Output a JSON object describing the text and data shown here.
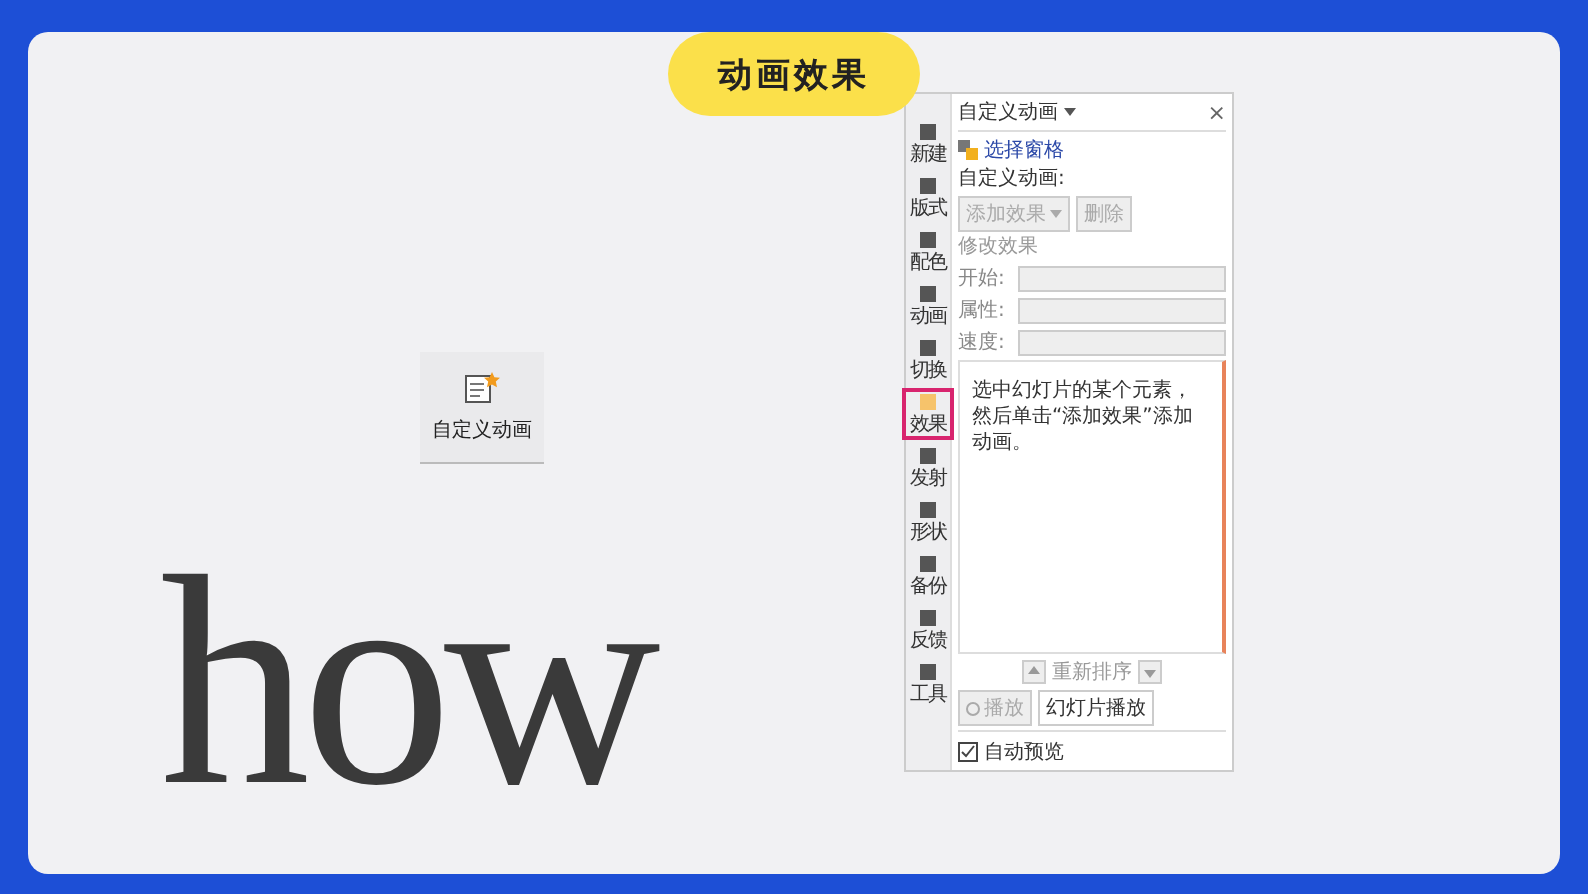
{
  "title": "动画效果",
  "slide_button": {
    "label": "自定义动画"
  },
  "big_text": "how",
  "panel": {
    "title": "自定义动画",
    "close": "×",
    "rail": [
      {
        "label": "新建",
        "selected": false
      },
      {
        "label": "版式",
        "selected": false
      },
      {
        "label": "配色",
        "selected": false
      },
      {
        "label": "动画",
        "selected": false
      },
      {
        "label": "切换",
        "selected": false
      },
      {
        "label": "效果",
        "selected": true
      },
      {
        "label": "发射",
        "selected": false
      },
      {
        "label": "形状",
        "selected": false
      },
      {
        "label": "备份",
        "selected": false
      },
      {
        "label": "反馈",
        "selected": false
      },
      {
        "label": "工具",
        "selected": false
      }
    ],
    "select_pane_link": "选择窗格",
    "section_label": "自定义动画:",
    "add_effect": {
      "label": "添加效果",
      "disabled": true
    },
    "delete": {
      "label": "删除",
      "disabled": true
    },
    "modify_label": "修改效果",
    "fields": [
      {
        "label": "开始:",
        "disabled": true
      },
      {
        "label": "属性:",
        "disabled": true
      },
      {
        "label": "速度:",
        "disabled": true
      }
    ],
    "list_hint": "选中幻灯片的某个元素，然后单击“添加效果”添加动画。",
    "reorder_label": "重新排序",
    "play": {
      "label": "播放",
      "disabled": true
    },
    "slideshow": {
      "label": "幻灯片播放",
      "disabled": false
    },
    "auto_preview": {
      "label": "自动预览",
      "checked": true
    }
  }
}
